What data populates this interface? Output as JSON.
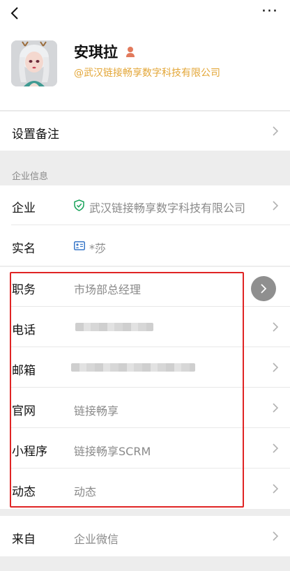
{
  "header": {
    "more_label": "···"
  },
  "profile": {
    "name": "安琪拉",
    "company": "@武汉链接畅享数字科技有限公司"
  },
  "remark_row": {
    "label": "设置备注"
  },
  "section": {
    "title": "企业信息"
  },
  "rows": [
    {
      "label": "企业",
      "value": "武汉链接畅享数字科技有限公司"
    },
    {
      "label": "实名",
      "value": "*莎"
    },
    {
      "label": "职务",
      "value": "市场部总经理"
    },
    {
      "label": "电话",
      "value": ""
    },
    {
      "label": "邮箱",
      "value": ""
    },
    {
      "label": "官网",
      "value": "链接畅享"
    },
    {
      "label": "小程序",
      "value": "链接畅享SCRM"
    },
    {
      "label": "动态",
      "value": "动态"
    }
  ],
  "source_row": {
    "label": "来自",
    "value": "企业微信"
  },
  "colors": {
    "accent": "#e3a637",
    "verified": "#18a35a",
    "highlight": "#e02424"
  }
}
